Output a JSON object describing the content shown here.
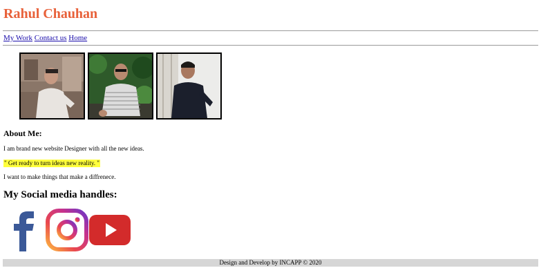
{
  "site": {
    "title": "Rahul Chauhan"
  },
  "nav": {
    "items": [
      "My Work",
      "Contact us",
      "Home"
    ]
  },
  "gallery": {
    "icon_names": [
      "photo-1",
      "photo-2",
      "photo-3"
    ]
  },
  "about": {
    "heading": "About Me:",
    "line1": "I am brand new website Designer with all the new ideas.",
    "quote": "\" Get ready to turn ideas new reality. \"",
    "line3": "I want to make things that make a diffrenece."
  },
  "social": {
    "heading": "My Social media handles:",
    "icons": [
      "facebook-icon",
      "instagram-icon",
      "youtube-icon"
    ]
  },
  "footer": {
    "text": "Design and Develop by INCAPP © 2020"
  },
  "colors": {
    "title": "#e8613a",
    "highlight": "#ffff3b",
    "footer_bg": "#d6d6d6",
    "facebook": "#3b5998",
    "youtube": "#d32b2b"
  }
}
